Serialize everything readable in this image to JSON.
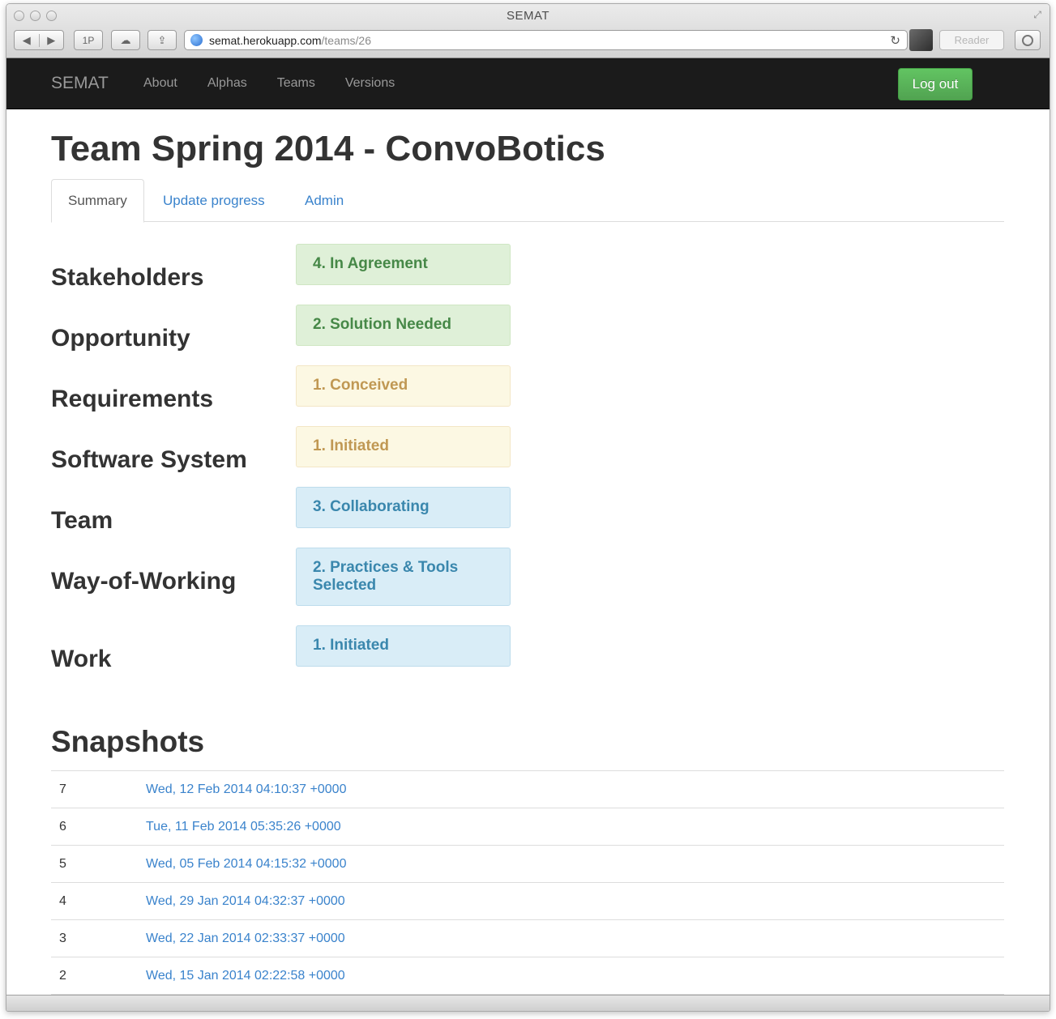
{
  "window": {
    "title": "SEMAT"
  },
  "toolbar": {
    "back_icon": "◀",
    "forward_icon": "▶",
    "onepassword_label": "1P",
    "cloud_icon": "☁",
    "share_icon": "⇪",
    "url_host": "semat.herokuapp.com",
    "url_path": "/teams/26",
    "reload_icon": "↻",
    "reader_label": "Reader"
  },
  "navbar": {
    "brand": "SEMAT",
    "links": [
      "About",
      "Alphas",
      "Teams",
      "Versions"
    ],
    "logout_label": "Log out"
  },
  "page": {
    "title": "Team Spring 2014 - ConvoBotics",
    "tabs": [
      "Summary",
      "Update progress",
      "Admin"
    ],
    "active_tab": "Summary"
  },
  "alphas": [
    {
      "name": "Stakeholders",
      "state": "4. In Agreement",
      "status": "green"
    },
    {
      "name": "Opportunity",
      "state": "2. Solution Needed",
      "status": "green"
    },
    {
      "name": "Requirements",
      "state": "1. Conceived",
      "status": "yellow"
    },
    {
      "name": "Software System",
      "state": "1. Initiated",
      "status": "yellow"
    },
    {
      "name": "Team",
      "state": "3. Collaborating",
      "status": "blue"
    },
    {
      "name": "Way-of-Working",
      "state": "2. Practices & Tools Selected",
      "status": "blue"
    },
    {
      "name": "Work",
      "state": "1. Initiated",
      "status": "blue"
    }
  ],
  "snapshots": {
    "title": "Snapshots",
    "rows": [
      {
        "num": "7",
        "date": "Wed, 12 Feb 2014 04:10:37 +0000"
      },
      {
        "num": "6",
        "date": "Tue, 11 Feb 2014 05:35:26 +0000"
      },
      {
        "num": "5",
        "date": "Wed, 05 Feb 2014 04:15:32 +0000"
      },
      {
        "num": "4",
        "date": "Wed, 29 Jan 2014 04:32:37 +0000"
      },
      {
        "num": "3",
        "date": "Wed, 22 Jan 2014 02:33:37 +0000"
      },
      {
        "num": "2",
        "date": "Wed, 15 Jan 2014 02:22:58 +0000"
      }
    ]
  },
  "colors": {
    "navbar_bg": "#1b1b1b",
    "success_button": "#5bb75b",
    "link_blue": "#3a83cc",
    "state_green_bg": "#dff0d8",
    "state_yellow_bg": "#fcf8e3",
    "state_blue_bg": "#d9edf7"
  }
}
